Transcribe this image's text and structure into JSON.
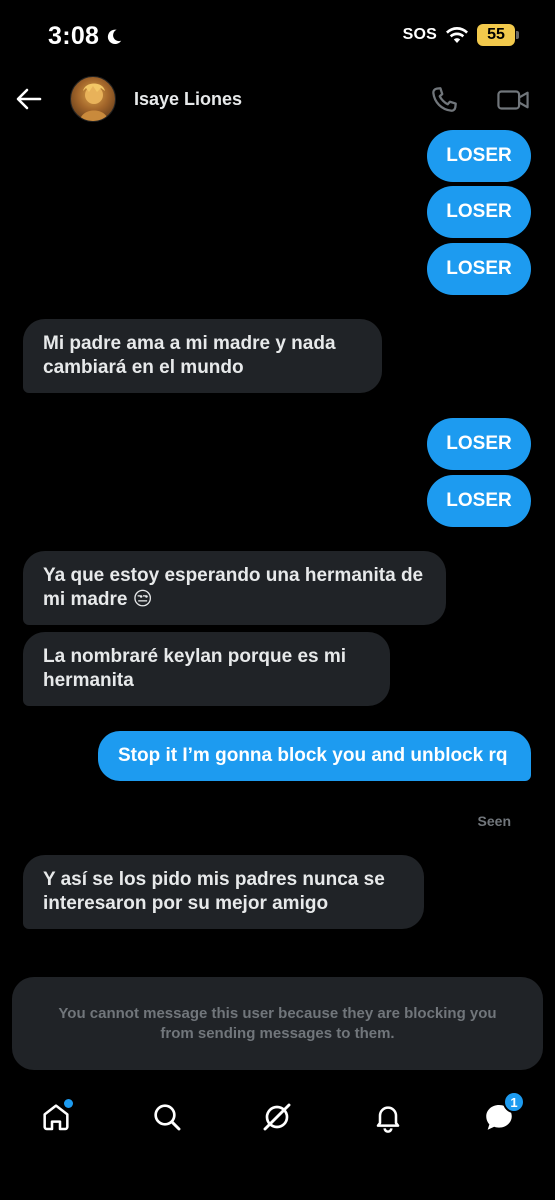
{
  "status_bar": {
    "time": "3:08",
    "sos": "SOS",
    "battery": "55"
  },
  "header": {
    "contact_name": "Isaye Liones"
  },
  "messages": [
    {
      "direction": "out",
      "text": "LOSER"
    },
    {
      "direction": "out",
      "text": "LOSER"
    },
    {
      "direction": "out",
      "text": "LOSER"
    },
    {
      "direction": "in",
      "text": "Mi padre ama a mi madre y nada cambiará en el mundo"
    },
    {
      "direction": "out",
      "text": "LOSER"
    },
    {
      "direction": "out",
      "text": "LOSER"
    },
    {
      "direction": "in",
      "text": "Ya que estoy esperando una hermanita de mi madre 😒"
    },
    {
      "direction": "in",
      "text": "La nombraré keylan porque es mi hermanita"
    },
    {
      "direction": "out",
      "text": "Stop it I’m gonna block you and unblock rq"
    },
    {
      "direction": "in",
      "text": "Y así se los pido mis padres nunca se interesaron por su mejor amigo"
    }
  ],
  "seen_label": "Seen",
  "blocked_notice": "You cannot message this user because they are blocking you from sending messages to them.",
  "bottom_nav": {
    "items": [
      "home-icon",
      "search-icon",
      "grok-icon",
      "notifications-icon",
      "messages-icon"
    ],
    "messages_badge": "1"
  },
  "colors": {
    "accent": "#1d9bf0",
    "incoming_bubble": "#202327",
    "muted_text": "#71767b",
    "battery": "#f2c94c"
  }
}
